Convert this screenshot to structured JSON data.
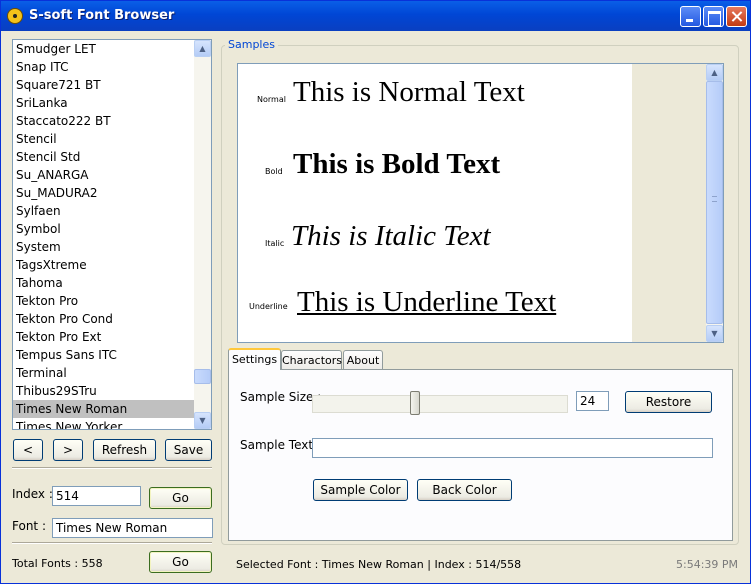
{
  "window": {
    "title": "S-soft Font Browser"
  },
  "fontlist": {
    "items": [
      "Smudger LET",
      "Snap ITC",
      "Square721 BT",
      "SriLanka",
      "Staccato222 BT",
      "Stencil",
      "Stencil Std",
      "Su_ANARGA",
      "Su_MADURA2",
      "Sylfaen",
      "Symbol",
      "System",
      "TagsXtreme",
      "Tahoma",
      "Tekton Pro",
      "Tekton Pro Cond",
      "Tekton Pro Ext",
      "Tempus Sans ITC",
      "Terminal",
      "Thibus29STru",
      "Times New Roman",
      "Times New Yorker"
    ],
    "selected": "Times New Roman"
  },
  "nav": {
    "prev": "<",
    "next": ">",
    "refresh": "Refresh",
    "save": "Save"
  },
  "left": {
    "index_label": "Index :",
    "index_value": "514",
    "go_label": "Go",
    "font_label": "Font :",
    "font_value": "Times New Roman",
    "total_label": "Total Fonts : 558",
    "go2_label": "Go"
  },
  "samples": {
    "legend": "Samples",
    "rows": [
      {
        "tag": "Normal",
        "text": "This is Normal Text"
      },
      {
        "tag": "Bold",
        "text": "This is Bold Text"
      },
      {
        "tag": "Italic",
        "text": "This is Italic Text"
      },
      {
        "tag": "Underline",
        "text": "This is Underline Text"
      }
    ]
  },
  "tabs": [
    "Settings",
    "Charactors",
    "About"
  ],
  "settings": {
    "size_label": "Sample Size :",
    "size_value": "24",
    "restore": "Restore",
    "text_label": "Sample Text :",
    "text_value": "",
    "sample_color": "Sample Color",
    "back_color": "Back Color",
    "slider_fraction": 0.4
  },
  "status": {
    "selected": "Selected Font : Times New Roman  |  Index : 514/558",
    "time": "5:54:39 PM"
  },
  "colors": {
    "title_bar": "#0054e3",
    "legend": "#0046d5",
    "tab_accent": "#ffc83c"
  }
}
